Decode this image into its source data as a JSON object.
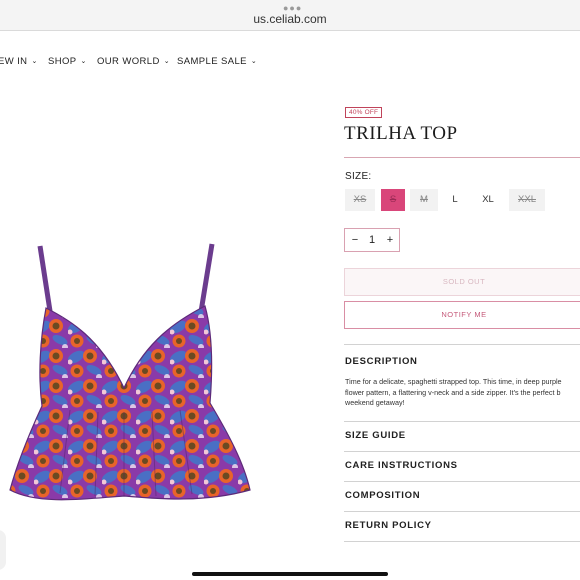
{
  "browser": {
    "url": "us.celiab.com"
  },
  "nav": {
    "items": [
      {
        "label": "EW IN"
      },
      {
        "label": "SHOP"
      },
      {
        "label": "OUR WORLD"
      },
      {
        "label": "SAMPLE SALE"
      }
    ]
  },
  "product": {
    "badge": "40% OFF",
    "title": "TRILHA TOP",
    "size_label": "SIZE:",
    "sizes": [
      {
        "label": "XS",
        "state": "unavailable"
      },
      {
        "label": "S",
        "state": "selected-unavailable"
      },
      {
        "label": "M",
        "state": "unavailable"
      },
      {
        "label": "L",
        "state": "available"
      },
      {
        "label": "XL",
        "state": "available"
      },
      {
        "label": "XXL",
        "state": "unavailable"
      }
    ],
    "quantity": {
      "minus": "−",
      "value": "1",
      "plus": "+"
    },
    "sold_out_label": "SOLD OUT",
    "notify_label": "NOTIFY ME",
    "description": {
      "title": "DESCRIPTION",
      "text": "Time for a delicate, spaghetti strapped top. This time, in deep purple\nflower pattern, a flattering v-neck and a side zipper. It's the perfect b\nweekend getaway!"
    },
    "accordions": [
      {
        "title": "SIZE GUIDE"
      },
      {
        "title": "CARE INSTRUCTIONS"
      },
      {
        "title": "COMPOSITION"
      },
      {
        "title": "RETURN POLICY"
      }
    ]
  },
  "colors": {
    "accent_pink": "#d9467a",
    "badge_red": "#c0435a",
    "print_purple": "#8a3aa8",
    "print_orange": "#e8642a",
    "print_blue": "#4a6fc4"
  }
}
